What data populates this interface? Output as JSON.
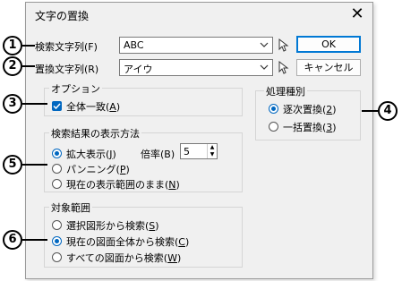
{
  "dialog": {
    "title": "文字の置換",
    "close_glyph": "✕"
  },
  "search": {
    "label": "検索文字列(F)",
    "value": "ABC"
  },
  "replace": {
    "label": "置換文字列(R)",
    "value": "アイウ"
  },
  "buttons": {
    "ok": "OK",
    "cancel": "キャンセル"
  },
  "options": {
    "title": "オプション",
    "match_whole": {
      "label": "全体一致(",
      "key": "A",
      "suffix": ")",
      "checked": true
    }
  },
  "process": {
    "title": "処理種別",
    "items": [
      {
        "label": "逐次置換(",
        "key": "2",
        "suffix": ")",
        "selected": true
      },
      {
        "label": "一括置換(",
        "key": "3",
        "suffix": ")",
        "selected": false
      }
    ]
  },
  "display": {
    "title": "検索結果の表示方法",
    "items": [
      {
        "label": "拡大表示(",
        "key": "J",
        "suffix": ")",
        "selected": true
      },
      {
        "label": "パンニング(",
        "key": "P",
        "suffix": ")",
        "selected": false
      },
      {
        "label": "現在の表示範囲のまま(",
        "key": "N",
        "suffix": ")",
        "selected": false
      }
    ],
    "zoom_label": "倍率(B)",
    "zoom_value": "5",
    "spin_up": "▲",
    "spin_down": "▼"
  },
  "scope": {
    "title": "対象範囲",
    "items": [
      {
        "label": "選択図形から検索(",
        "key": "S",
        "suffix": ")",
        "selected": false
      },
      {
        "label": "現在の図面全体から検索(",
        "key": "C",
        "suffix": ")",
        "selected": true
      },
      {
        "label": "すべての図面から検索(",
        "key": "W",
        "suffix": ")",
        "selected": false
      }
    ]
  },
  "callouts": [
    "1",
    "2",
    "3",
    "4",
    "5",
    "6"
  ],
  "colors": {
    "accent": "#0067c0",
    "dialog_bg": "#f0f0f0",
    "default_border": "#0078d4"
  }
}
